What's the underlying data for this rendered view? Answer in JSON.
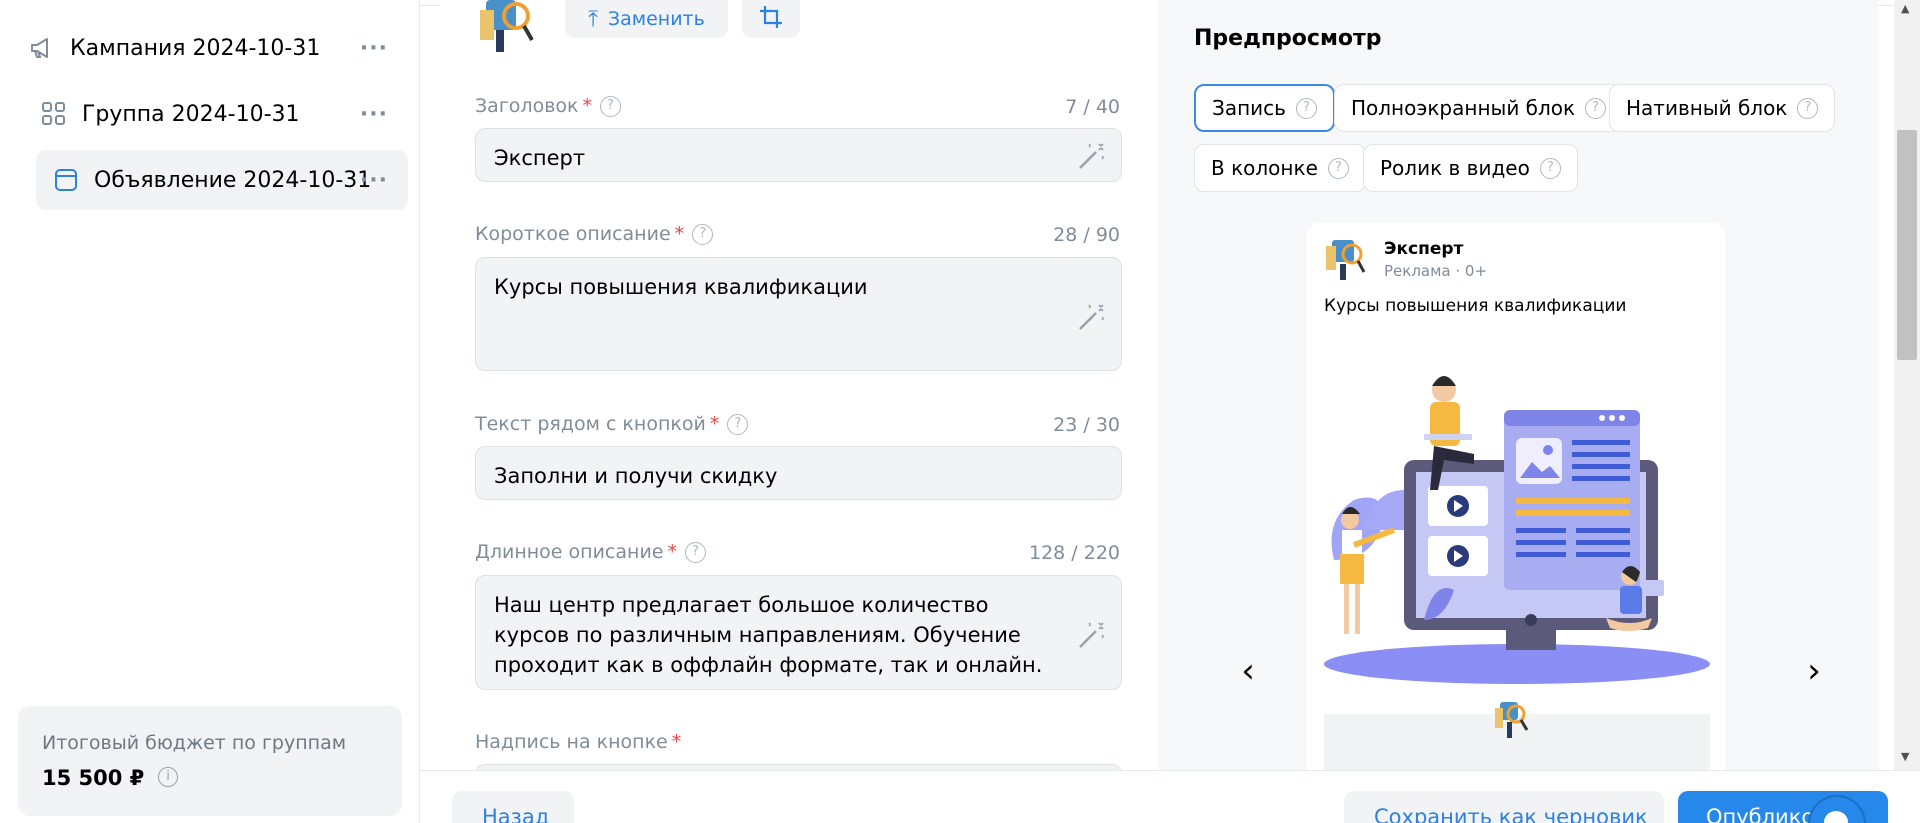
{
  "sidebar": {
    "items": [
      {
        "label": "Кампания 2024-10-31",
        "icon": "megaphone-icon",
        "more": "···"
      },
      {
        "label": "Группа 2024-10-31",
        "icon": "grid-icon",
        "more": "···"
      },
      {
        "label": "Объявление 2024-10-31",
        "icon": "ad-card-icon",
        "more": "···"
      }
    ],
    "budget": {
      "label": "Итоговый бюджет по группам",
      "value": "15 500 ₽",
      "info": "i"
    }
  },
  "form": {
    "replace_label": "Заменить",
    "fields": [
      {
        "label": "Заголовок",
        "counter": "7 / 40",
        "value": "Эксперт"
      },
      {
        "label": "Короткое описание",
        "counter": "28 / 90",
        "value": "Курсы повышения квалификации"
      },
      {
        "label": "Текст рядом с кнопкой",
        "counter": "23 / 30",
        "value": "Заполни и получи скидку"
      },
      {
        "label": "Длинное описание",
        "counter": "128 / 220",
        "value": "Наш центр предлагает большое количество курсов по различным направлениям. Обучение проходит как в оффлайн формате, так и онлайн."
      },
      {
        "label": "Надпись на кнопке",
        "counter": "",
        "value": ""
      }
    ],
    "required_mark": "*",
    "help_mark": "?"
  },
  "preview": {
    "title": "Предпросмотр",
    "tabs": [
      {
        "label": "Запись",
        "active": true
      },
      {
        "label": "Полноэкранный блок",
        "active": false
      },
      {
        "label": "Нативный блок",
        "active": false
      },
      {
        "label": "В колонке",
        "active": false
      },
      {
        "label": "Ролик в видео",
        "active": false
      }
    ],
    "card": {
      "name": "Эксперт",
      "meta": "Реклама · 0+",
      "description": "Курсы повышения квалификации"
    },
    "prev_arrow": "‹",
    "next_arrow": "›"
  },
  "actions": {
    "back": "Назад",
    "save_draft": "Сохранить как черновик",
    "publish": "Опублико"
  },
  "colors": {
    "accent": "#2688eb",
    "link": "#2d81e0",
    "required": "#e64646",
    "muted": "#818c99"
  }
}
